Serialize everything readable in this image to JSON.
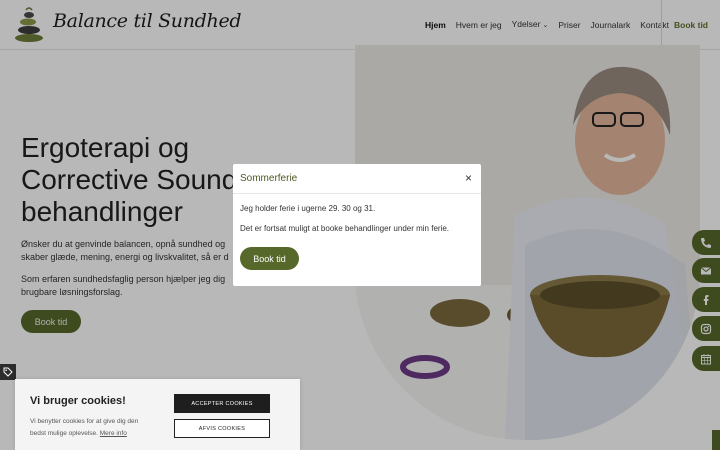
{
  "header": {
    "logo_text": "Balance til Sundhed",
    "nav": [
      "Hjem",
      "Hvem er jeg",
      "Ydelser",
      "Priser",
      "Journalark",
      "Kontakt"
    ],
    "book_label": "Book tid",
    "caret": "⌄"
  },
  "hero": {
    "title_line1": "Ergoterapi og",
    "title_line2": "Corrective Sound",
    "title_line3": "behandlinger",
    "para1_line1": "Ønsker du at genvinde balancen, opnå sundhed og",
    "para1_line2": "skaber glæde, mening, energi og livskvalitet, så er d",
    "para2_line1": "Som erfaren sundhedsfaglig person hjælper jeg dig",
    "para2_line2": "brugbare løsningsforslag.",
    "book_label": "Book tid"
  },
  "modal": {
    "title": "Sommerferie",
    "close": "×",
    "line1": "Jeg holder ferie i ugerne 29. 30 og 31.",
    "line2": "Det er fortsat muligt at booke behandlinger under min ferie.",
    "button": "Book tid"
  },
  "cookie": {
    "title": "Vi bruger cookies!",
    "text": "Vi benytter cookies for at give dig den bedst mulige oplevelse.",
    "more": "Mere info",
    "accept": "ACCEPTER COOKIES",
    "decline": "AFVIS COOKIES"
  },
  "social": [
    "phone-icon",
    "mail-icon",
    "facebook-icon",
    "instagram-icon",
    "calendar-icon"
  ],
  "colors": {
    "accent": "#56682a",
    "modal_title": "#4c5a24"
  }
}
